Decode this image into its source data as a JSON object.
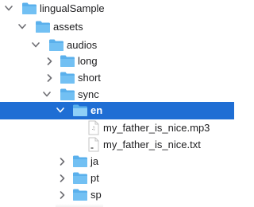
{
  "tree": {
    "root": {
      "label": "lingualSample",
      "expanded": true
    },
    "assets": {
      "label": "assets",
      "expanded": true
    },
    "audios": {
      "label": "audios",
      "expanded": true
    },
    "long": {
      "label": "long",
      "expanded": false
    },
    "short": {
      "label": "short",
      "expanded": false
    },
    "sync": {
      "label": "sync",
      "expanded": true
    },
    "en": {
      "label": "en",
      "expanded": true,
      "selected": true
    },
    "mp3": {
      "label": "my_father_is_nice.mp3"
    },
    "txt": {
      "label": "my_father_is_nice.txt"
    },
    "ja": {
      "label": "ja",
      "expanded": false
    },
    "pt": {
      "label": "pt",
      "expanded": false
    },
    "sp": {
      "label": "sp",
      "expanded": false
    }
  },
  "colors": {
    "selection": "#1f6ed4",
    "folder": "#5ab0ec",
    "chevron": "#6e6e73"
  }
}
